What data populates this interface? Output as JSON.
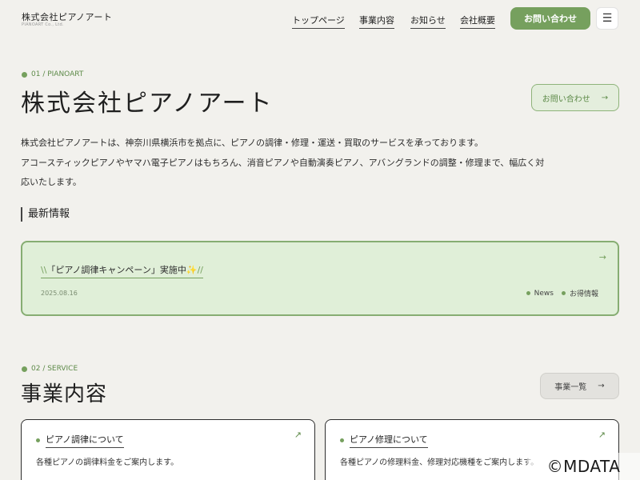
{
  "header": {
    "logo_main": "株式会社ピアノアート",
    "logo_sub": "PIANOART Co., Ltd.",
    "nav": [
      "トップページ",
      "事業内容",
      "お知らせ",
      "会社概要"
    ],
    "contact_button": "お問い合わせ",
    "menu_icon": "☰"
  },
  "hero": {
    "section_label": "01 / PIANOART",
    "title": "株式会社ピアノアート",
    "contact_button": "お問い合わせ",
    "arrow": "→",
    "intro_lines": [
      "株式会社ピアノアートは、神奈川県横浜市を拠点に、ピアノの調律・修理・運送・買取のサービスを承っております。",
      "アコースティックピアノやヤマハ電子ピアノはもちろん、消音ピアノや自動演奏ピアノ、アバングランドの調整・修理まで、幅広く対",
      "応いたします。"
    ]
  },
  "news": {
    "heading": "最新情報",
    "item": {
      "prefix": "\\\\",
      "title": "「ピアノ調律キャンペーン」実施中",
      "sparkle": "✨",
      "suffix": "//",
      "date": "2025.08.16",
      "tags": [
        "News",
        "お得情報"
      ],
      "arrow": "→"
    }
  },
  "service": {
    "section_label": "02 / SERVICE",
    "title": "事業内容",
    "list_button": "事業一覧",
    "arrow": "→",
    "cards": [
      {
        "title": "ピアノ調律について",
        "desc": "各種ピアノの調律料金をご案内します。",
        "arrow": "↗"
      },
      {
        "title": "ピアノ修理について",
        "desc": "各種ピアノの修理料金、修理対応機種をご案内します。",
        "arrow": "↗"
      }
    ]
  },
  "watermark": "©MDATA",
  "colors": {
    "accent": "#76a05e",
    "background": "#f2f1ed",
    "news_bg": "#e0efd8"
  }
}
